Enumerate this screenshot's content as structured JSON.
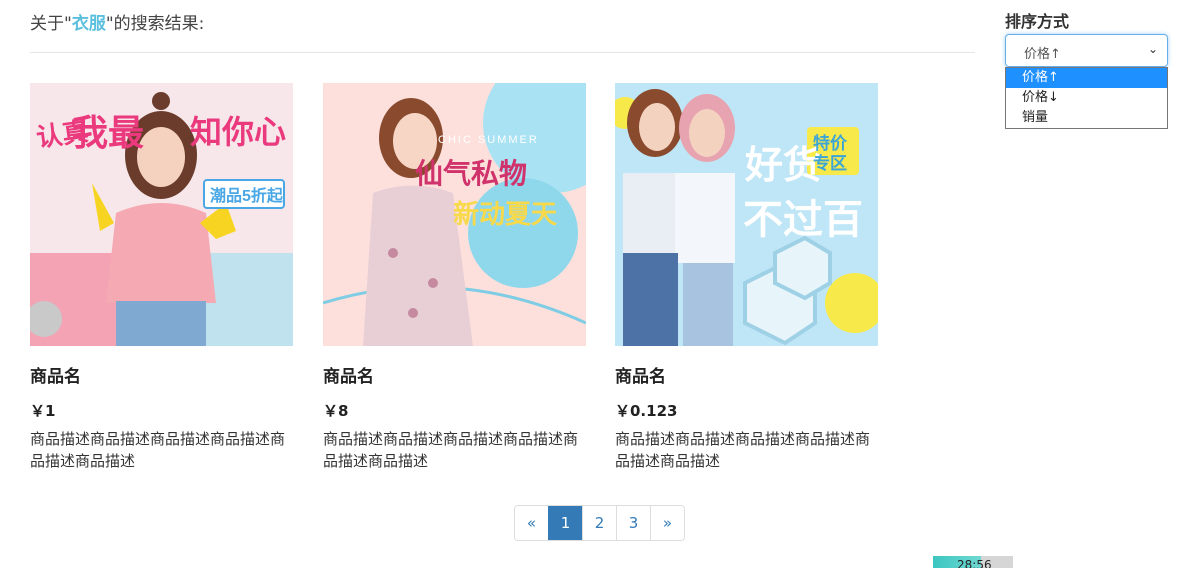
{
  "search": {
    "prefix": "关于\"",
    "keyword": "衣服",
    "suffix": "\"的搜索结果:"
  },
  "sort": {
    "label": "排序方式",
    "selected": "价格↑",
    "options": [
      "价格↑",
      "价格↓",
      "销量"
    ]
  },
  "products": [
    {
      "name": "商品名",
      "price": "￥1",
      "desc": "商品描述商品描述商品描述商品描述商品描述商品描述",
      "banner_text": [
        "认真",
        "我最",
        "知你心",
        "潮品5折起"
      ]
    },
    {
      "name": "商品名",
      "price": "￥8",
      "desc": "商品描述商品描述商品描述商品描述商品描述商品描述",
      "banner_text": [
        "CHIC SUMMER",
        "仙气私物",
        "新动夏天"
      ]
    },
    {
      "name": "商品名",
      "price": "￥0.123",
      "desc": "商品描述商品描述商品描述商品描述商品描述商品描述",
      "banner_text": [
        "好货",
        "不过百",
        "特价",
        "专区"
      ]
    }
  ],
  "pagination": {
    "prev": "«",
    "pages": [
      "1",
      "2",
      "3"
    ],
    "current": "1",
    "next": "»"
  },
  "timer": "28:56",
  "colors": {
    "keyword": "#5bc0de",
    "pagination_active": "#337ab7",
    "option_selected": "#1e90ff"
  }
}
